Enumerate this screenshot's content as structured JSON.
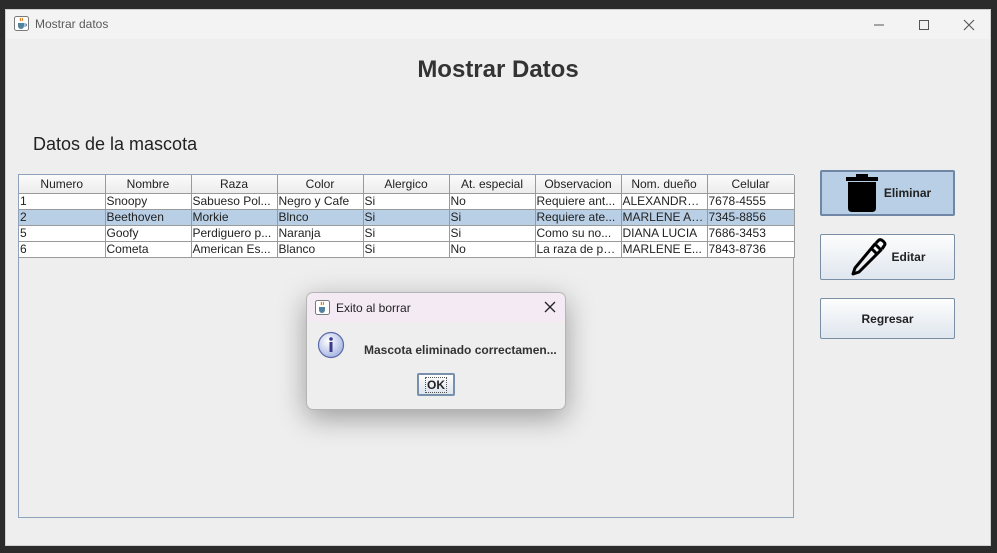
{
  "window": {
    "title": "Mostrar datos",
    "controls": [
      "minimize",
      "maximize",
      "close"
    ]
  },
  "main": {
    "heading": "Mostrar Datos",
    "subheading": "Datos de la mascota"
  },
  "table": {
    "columns": [
      "Numero",
      "Nombre",
      "Raza",
      "Color",
      "Alergico",
      "At. especial",
      "Observacion",
      "Nom. dueño",
      "Celular"
    ],
    "selected_row": 1,
    "rows": [
      [
        "1",
        "Snoopy",
        "Sabueso Pol...",
        "Negro y Cafe",
        "Si",
        "No",
        "Requiere ant...",
        "ALEXANDRA ...",
        "7678-4555"
      ],
      [
        "2",
        "Beethoven",
        "Morkie",
        "Blnco",
        "Si",
        "Si",
        "Requiere ate...",
        "MARLENE AL...",
        "7345-8856"
      ],
      [
        "5",
        "Goofy",
        "Perdiguero p...",
        "Naranja",
        "Si",
        "Si",
        "Como su no...",
        "DIANA LUCIA",
        "7686-3453"
      ],
      [
        "6",
        "Cometa",
        "American Es...",
        "Blanco",
        "Si",
        "No",
        "La raza de pe...",
        "MARLENE E...",
        "7843-8736"
      ]
    ]
  },
  "buttons": {
    "delete": "Eliminar",
    "edit": "Editar",
    "back": "Regresar"
  },
  "dialog": {
    "title": "Exito al borrar",
    "message": "Mascota eliminado correctamen...",
    "ok": "OK"
  },
  "colors": {
    "selection": "#b8cfe5",
    "button_border": "#7a8ea5",
    "dialog_titlebar": "#f4eaf4"
  },
  "icons": {
    "app": "java-cup-icon",
    "delete": "trash-icon",
    "edit": "pencil-icon",
    "dialog": "info-icon"
  }
}
